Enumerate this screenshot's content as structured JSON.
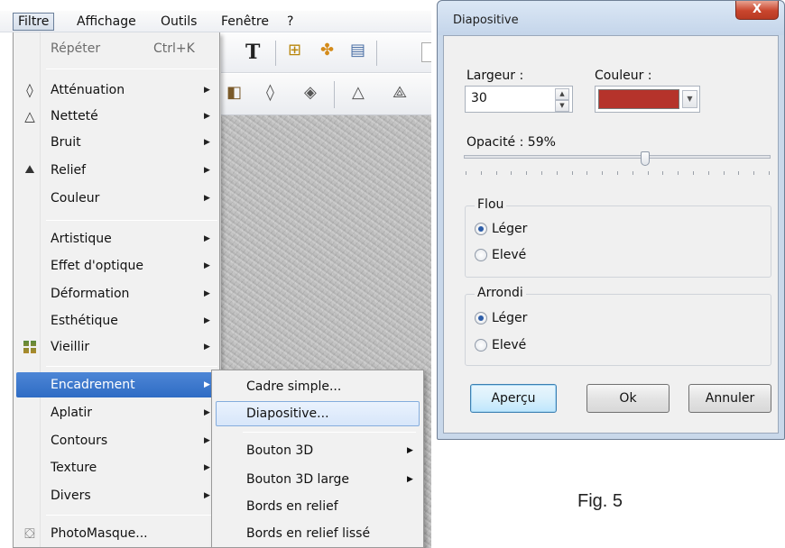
{
  "menubar": {
    "items": [
      "Filtre",
      "Affichage",
      "Outils",
      "Fenêtre",
      "?"
    ]
  },
  "filter_menu": {
    "repeat": {
      "label": "Répéter",
      "shortcut": "Ctrl+K"
    },
    "items": [
      {
        "label": "Atténuation",
        "icon": "water-drop-outline-icon"
      },
      {
        "label": "Netteté",
        "icon": "triangle-outline-icon"
      },
      {
        "label": "Bruit"
      },
      {
        "label": "Relief",
        "icon": "relief-mountains-icon"
      },
      {
        "label": "Couleur"
      },
      {
        "label": "Artistique"
      },
      {
        "label": "Effet d'optique"
      },
      {
        "label": "Déformation"
      },
      {
        "label": "Esthétique"
      },
      {
        "label": "Vieillir",
        "icon": "grid-tiles-icon"
      },
      {
        "label": "Encadrement"
      },
      {
        "label": "Aplatir"
      },
      {
        "label": "Contours"
      },
      {
        "label": "Texture"
      },
      {
        "label": "Divers"
      },
      {
        "label": "PhotoMasque...",
        "icon": "photomask-icon"
      }
    ]
  },
  "frame_submenu": {
    "items": [
      {
        "label": "Cadre simple..."
      },
      {
        "label": "Diapositive..."
      },
      {
        "label": "Bouton 3D"
      },
      {
        "label": "Bouton 3D large"
      },
      {
        "label": "Bords en relief"
      },
      {
        "label": "Bords en relief lissé"
      }
    ]
  },
  "toolbar": {
    "text_tool": "T"
  },
  "dialog": {
    "title": "Diapositive",
    "close": "X",
    "width_label": "Largeur :",
    "width_value": "30",
    "color_label": "Couleur :",
    "color": "#b5332b",
    "opacity_label": "Opacité : 59%",
    "opacity_value": 0.59,
    "blur_group": {
      "title": "Flou",
      "options": [
        "Léger",
        "Elevé"
      ],
      "selected": 0
    },
    "round_group": {
      "title": "Arrondi",
      "options": [
        "Léger",
        "Elevé"
      ],
      "selected": 0
    },
    "buttons": {
      "preview": "Aperçu",
      "ok": "Ok",
      "cancel": "Annuler"
    }
  },
  "caption": "Fig. 5"
}
